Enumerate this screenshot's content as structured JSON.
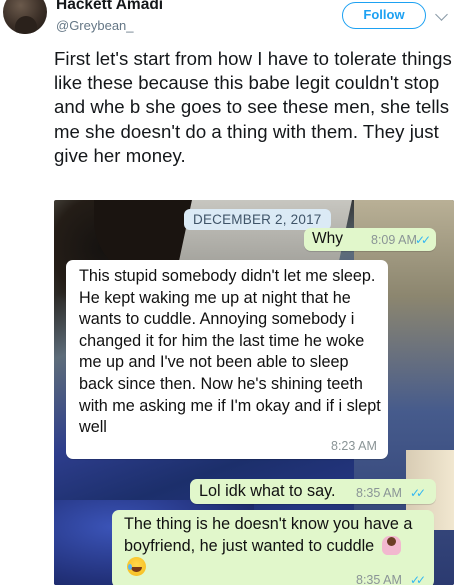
{
  "tweet": {
    "display_name": "Hackett Amadi",
    "handle": "@Greybean_",
    "follow_label": "Follow",
    "text": "First let's start from how I have to tolerate things like these because this babe legit couldn't stop and whe b she goes to see these men, she tells me she doesn't do a thing with them. They just give her money."
  },
  "chat": {
    "date_chip": "DECEMBER 2, 2017",
    "messages": [
      {
        "direction": "outgoing",
        "text": "Why",
        "time": "8:09 AM",
        "status_icon": "double-check-read-icon"
      },
      {
        "direction": "incoming",
        "text": "This stupid somebody didn't let me sleep. He kept waking me up at night that he wants to cuddle. Annoying somebody i changed it for him the last time he woke me up and I've not been able to sleep back since then. Now he's shining teeth with me asking me if I'm okay and if i slept well",
        "time": "8:23 AM"
      },
      {
        "direction": "outgoing",
        "text": "Lol idk what to say.",
        "time": "8:35 AM",
        "status_icon": "double-check-read-icon"
      },
      {
        "direction": "outgoing",
        "text": "The thing is he doesn't know you have a boyfriend, he just wanted to cuddle",
        "emojis": [
          "person-shrugging-icon",
          "face-with-tears-of-joy-icon"
        ],
        "time": "8:35 AM",
        "status_icon": "double-check-read-icon"
      }
    ]
  },
  "colors": {
    "twitter_blue": "#1da1f2",
    "whatsapp_outgoing": "#e1f7cb",
    "whatsapp_incoming": "#ffffff",
    "read_ticks": "#34b7f1",
    "date_chip_bg": "#dbeaf5"
  }
}
